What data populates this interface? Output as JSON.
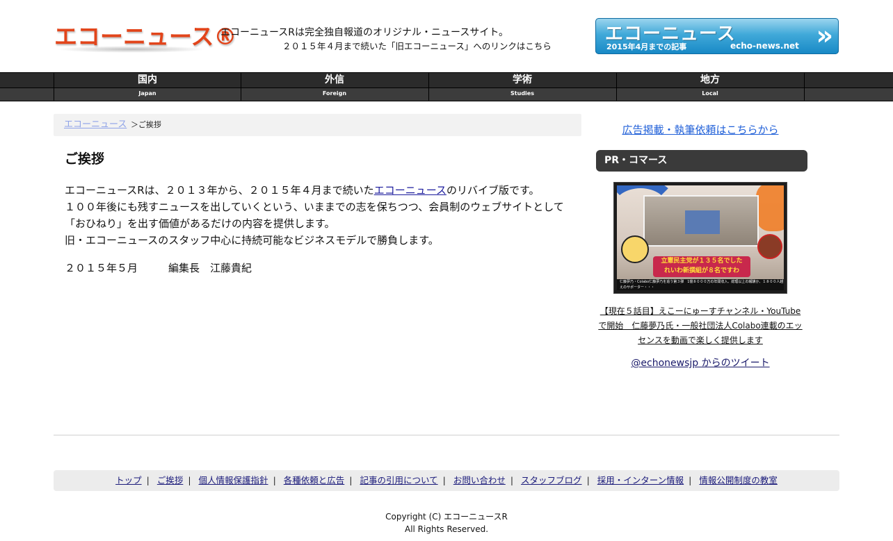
{
  "header": {
    "logo_text": "エコーニュース®",
    "tagline": "エコーニュースRは完全独自報道のオリジナル・ニュースサイト。",
    "old_site_link": "２０１５年４月まで続いた「旧エコーニュース」へのリンクはこちら",
    "banner": {
      "title": "エコーニュース",
      "subtitle": "2015年4月までの記事",
      "url": "echo-news.net",
      "arrows": "»"
    }
  },
  "nav": {
    "items": [
      {
        "jp": "国内",
        "en": "Japan"
      },
      {
        "jp": "外信",
        "en": "Foreign"
      },
      {
        "jp": "学術",
        "en": "Studies"
      },
      {
        "jp": "地方",
        "en": "Local"
      }
    ]
  },
  "breadcrumb": {
    "home": "エコーニュース",
    "current": "＞ご挨拶"
  },
  "main": {
    "title": "ご挨拶",
    "paragraph_1_before": "エコーニュースRは、２０１３年から、２０１５年４月まで続いた",
    "paragraph_1_link": "エコーニュース",
    "paragraph_1_after": "のリバイブ版です。",
    "paragraph_2": "１００年後にも残すニュースを出していくという、いままでの志を保ちつつ、会員制のウェブサイトとして「おひねり」を出す価値があるだけの内容を提供します。",
    "paragraph_3": "旧・エコーニュースのスタッフ中心に持続可能なビジネスモデルで勝負します。",
    "signature_date": "２０１５年５月",
    "signature_name": "編集長　江藤貴紀"
  },
  "sidebar": {
    "ad_link": "広告掲載・執筆依頼はこちらから",
    "pr_label": "PR・コマース",
    "thumbnail": {
      "caption_line1": "立憲民主党が１３５名でした",
      "caption_line2": "れいわ新撰組が８名ですわ",
      "bar_line1": "仁藤夢乃・Colabo仁藤夢乃を追う第３弾　1億８０００万の年間収入、総理以上の報酬か、１８００人越",
      "bar_line2": "えのサポーター・・・"
    },
    "article_link": "【現在５話目】えこーにゅーすチャンネル・YouTubeで開始　仁藤夢乃氏・一般社団法人Colabo連載のエッセンスを動画で楽しく提供します",
    "tweets_link": "@echonewsjp からのツイート"
  },
  "footer": {
    "links": [
      "トップ",
      "ご挨拶",
      "個人情報保護指針",
      "各種依頼と広告",
      "記事の引用について",
      "お問い合わせ",
      "スタッフブログ",
      "採用・インターン情報",
      "情報公開制度の教室"
    ],
    "separator": "|",
    "copyright_line1": "Copyright (C) エコーニュースR",
    "copyright_line2": "All Rights Reserved."
  },
  "colors": {
    "logo": "#e2451b",
    "nav_bg": "#2b2b2b",
    "banner_blue": "#1788c5",
    "link": "#1a1a9c"
  }
}
